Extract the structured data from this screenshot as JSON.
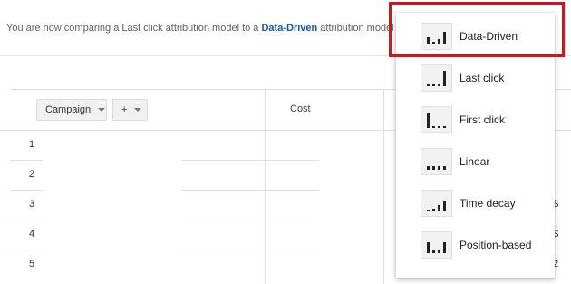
{
  "banner": {
    "prefix": "You are now comparing a Last click attribution model to a ",
    "link": "Data-Driven",
    "suffix": " attribution model"
  },
  "table": {
    "dimension_button": "Campaign",
    "add_button": "+",
    "cost_header": "Cost",
    "rows": [
      "1",
      "2",
      "3",
      "4",
      "5"
    ],
    "edge_chars": [
      "$",
      "$",
      "2"
    ]
  },
  "menu": {
    "items": [
      {
        "label": "Data-Driven",
        "icon": "data-driven-icon",
        "bars": [
          0.45,
          0.2,
          0.35,
          0.8
        ],
        "selected": true
      },
      {
        "label": "Last click",
        "icon": "last-click-icon",
        "bars": [
          0.1,
          0.1,
          0.1,
          1.0
        ]
      },
      {
        "label": "First click",
        "icon": "first-click-icon",
        "bars": [
          1.0,
          0.1,
          0.1,
          0.1
        ]
      },
      {
        "label": "Linear",
        "icon": "linear-icon",
        "bars": [
          0.25,
          0.25,
          0.25,
          0.25
        ]
      },
      {
        "label": "Time decay",
        "icon": "time-decay-icon",
        "bars": [
          0.1,
          0.2,
          0.4,
          0.7
        ]
      },
      {
        "label": "Position-based",
        "icon": "position-based-icon",
        "bars": [
          0.7,
          0.2,
          0.2,
          0.7
        ]
      }
    ]
  },
  "colors": {
    "highlight": "#d6121b",
    "link": "#1a56a8",
    "icon_bar": "#222222"
  }
}
